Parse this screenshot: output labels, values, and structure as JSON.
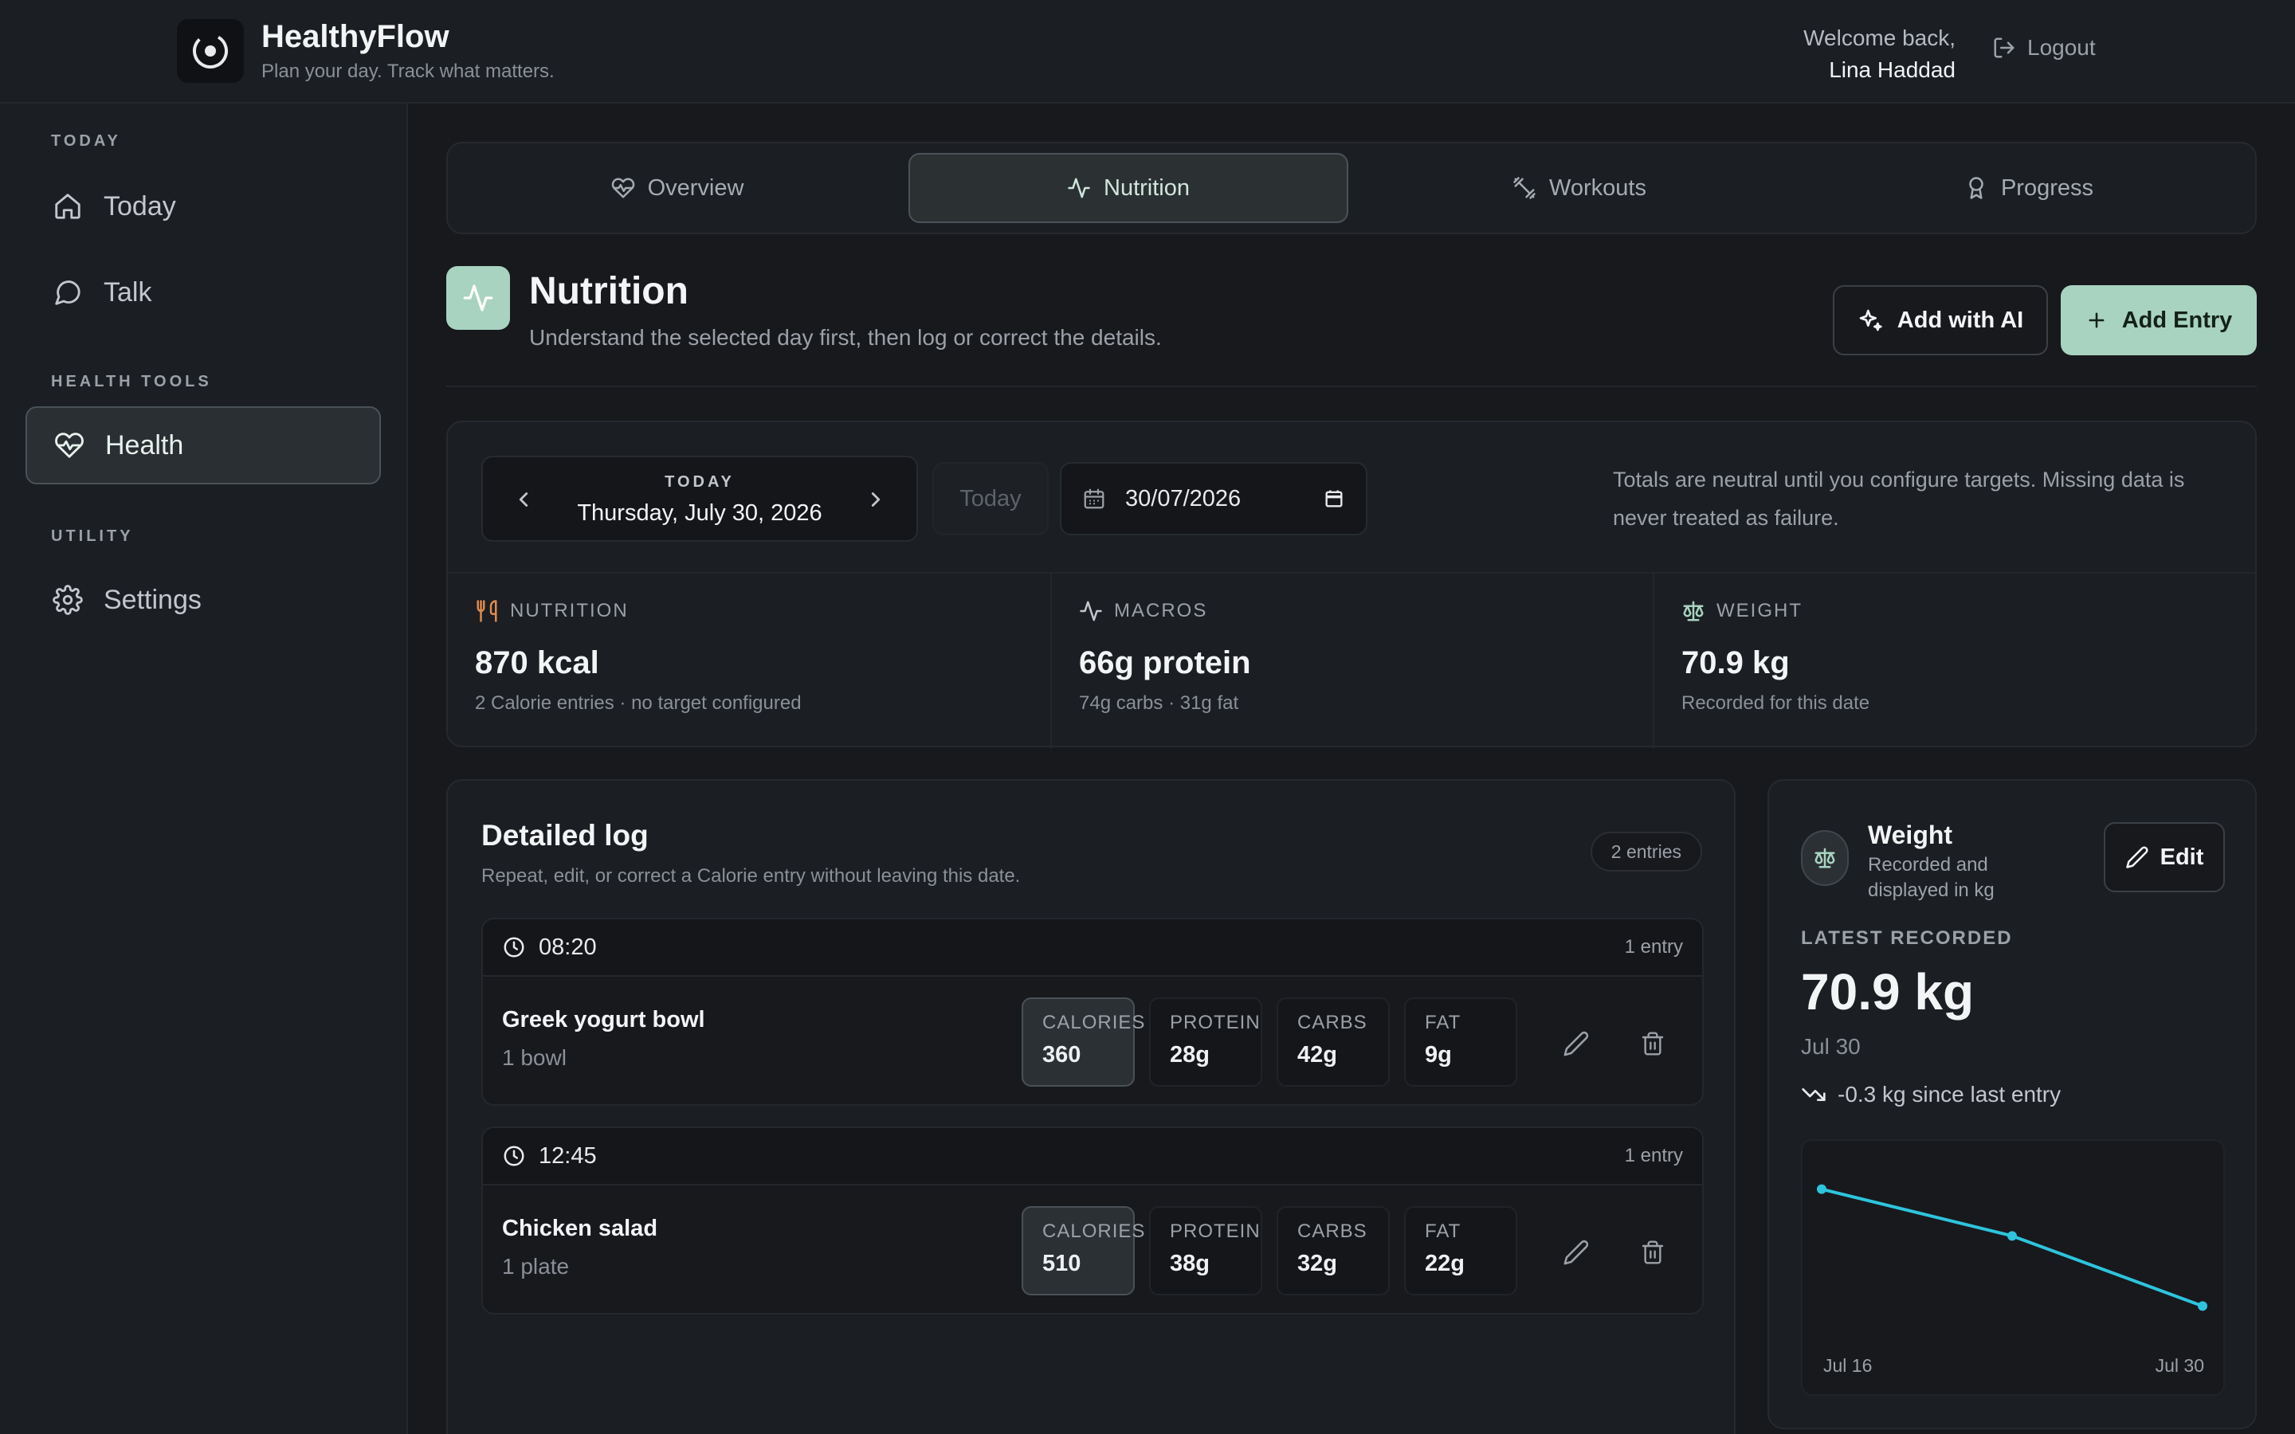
{
  "app": {
    "name": "HealthyFlow",
    "tagline": "Plan your day. Track what matters.",
    "welcome_line1": "Welcome back,",
    "user_name": "Lina Haddad",
    "logout_label": "Logout"
  },
  "sidebar": {
    "sections": [
      "TODAY",
      "HEALTH TOOLS",
      "UTILITY"
    ],
    "items": [
      {
        "label": "Today",
        "icon": "home-icon"
      },
      {
        "label": "Talk",
        "icon": "chat-bubble-icon"
      },
      {
        "label": "Health",
        "icon": "heart-pulse-icon",
        "active": true
      },
      {
        "label": "Settings",
        "icon": "gear-icon"
      }
    ]
  },
  "tabs": [
    {
      "label": "Overview",
      "icon": "heart-pulse-icon"
    },
    {
      "label": "Nutrition",
      "icon": "activity-icon",
      "active": true
    },
    {
      "label": "Workouts",
      "icon": "dumbbell-icon"
    },
    {
      "label": "Progress",
      "icon": "award-icon"
    }
  ],
  "page": {
    "title": "Nutrition",
    "subtitle": "Understand the selected day first, then log or correct the details.",
    "add_ai_label": "Add with AI",
    "add_entry_label": "Add Entry"
  },
  "summary": {
    "date_caption": "TODAY",
    "date_full": "Thursday, July 30, 2026",
    "today_button": "Today",
    "date_input_value": "30/07/2026",
    "note": "Totals are neutral until you configure targets. Missing data is never treated as failure.",
    "stats": [
      {
        "label": "NUTRITION",
        "icon": "utensils-icon",
        "value": "870 kcal",
        "desc": "2 Calorie entries · no target configured"
      },
      {
        "label": "MACROS",
        "icon": "activity-icon",
        "value": "66g protein",
        "desc": "74g carbs · 31g fat"
      },
      {
        "label": "WEIGHT",
        "icon": "scale-icon",
        "value": "70.9 kg",
        "desc": "Recorded for this date"
      }
    ]
  },
  "log": {
    "title": "Detailed log",
    "subtitle": "Repeat, edit, or correct a Calorie entry without leaving this date.",
    "badge": "2 entries",
    "meals": [
      {
        "time": "08:20",
        "count": "1 entry",
        "name": "Greek yogurt bowl",
        "qty": "1 bowl",
        "macros": [
          {
            "label": "CALORIES",
            "value": "360"
          },
          {
            "label": "PROTEIN",
            "value": "28g"
          },
          {
            "label": "CARBS",
            "value": "42g"
          },
          {
            "label": "FAT",
            "value": "9g"
          }
        ]
      },
      {
        "time": "12:45",
        "count": "1 entry",
        "name": "Chicken salad",
        "qty": "1 plate",
        "macros": [
          {
            "label": "CALORIES",
            "value": "510"
          },
          {
            "label": "PROTEIN",
            "value": "38g"
          },
          {
            "label": "CARBS",
            "value": "32g"
          },
          {
            "label": "FAT",
            "value": "22g"
          }
        ]
      }
    ]
  },
  "weight": {
    "title": "Weight",
    "subtitle": "Recorded and displayed in kg",
    "edit_label": "Edit",
    "latest_label": "LATEST RECORDED",
    "latest_value": "70.9 kg",
    "latest_date": "Jul 30",
    "trend": "-0.3 kg since last entry"
  },
  "chart_data": {
    "type": "line",
    "x": [
      "Jul 16",
      "Jul 23",
      "Jul 30"
    ],
    "xtick_labels": [
      "Jul 16",
      "Jul 30"
    ],
    "series": [
      {
        "values": [
          71.4,
          71.2,
          70.9
        ]
      }
    ],
    "ylim": [
      70.85,
      71.45
    ],
    "grid": false,
    "color": "#2ec4dd"
  },
  "colors": {
    "accent": "#a8d3c0",
    "background": "#17191d",
    "panel": "#1b1e22",
    "chart_line": "#2ec4dd",
    "nutrition_icon": "#e08a4c"
  }
}
